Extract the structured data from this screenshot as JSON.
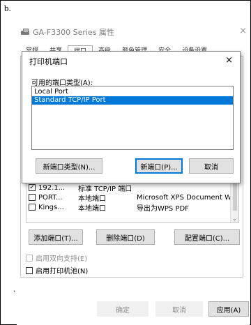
{
  "caption": "b.",
  "stray_mark": ".",
  "main_window": {
    "title": "GA-F3300 Series 属性",
    "close_glyph": "×",
    "tabs": [
      {
        "label": "常规",
        "active": false
      },
      {
        "label": "共享",
        "active": false
      },
      {
        "label": "端口",
        "active": true
      },
      {
        "label": "高级",
        "active": false
      },
      {
        "label": "颜色管理",
        "active": false
      },
      {
        "label": "安全",
        "active": false
      },
      {
        "label": "设备设置",
        "active": false
      }
    ],
    "ports": [
      {
        "checked": true,
        "check_glyph": "✓",
        "name": "192.1...",
        "description": "标准 TCP/IP 端口",
        "printer": ""
      },
      {
        "checked": false,
        "check_glyph": "",
        "name": "PORT...",
        "description": "本地端口",
        "printer": "Microsoft XPS Document W..."
      },
      {
        "checked": false,
        "check_glyph": "",
        "name": "Kings...",
        "description": "本地端口",
        "printer": "导出为WPS PDF"
      }
    ],
    "buttons": {
      "add_port": "添加端口(T)...",
      "delete_port": "删除端口(D)",
      "configure_port": "配置端口(C)..."
    },
    "checkboxes": {
      "bidirectional": "启用双向支持(E)",
      "pooling": "启用打印机池(N)"
    },
    "footer": {
      "ok": "确定",
      "cancel": "取消",
      "apply": "应用(A)"
    }
  },
  "dialog": {
    "title": "打印机端口",
    "close_glyph": "×",
    "available_types_label": "可用的端口类型(A):",
    "port_types": [
      {
        "label": "Local Port",
        "selected": false
      },
      {
        "label": "Standard TCP/IP Port",
        "selected": true
      }
    ],
    "buttons": {
      "new_port_type": "新端口类型(N)...",
      "new_port": "新端口(P)...",
      "cancel": "取消"
    }
  },
  "colors": {
    "selection": "#0078d7",
    "disabled_text": "#8f8f8f"
  },
  "icons": {
    "printer": "printer-icon",
    "close": "close-icon",
    "checkbox": "checkbox-icon",
    "scroll_down": "chevron-down-icon"
  }
}
